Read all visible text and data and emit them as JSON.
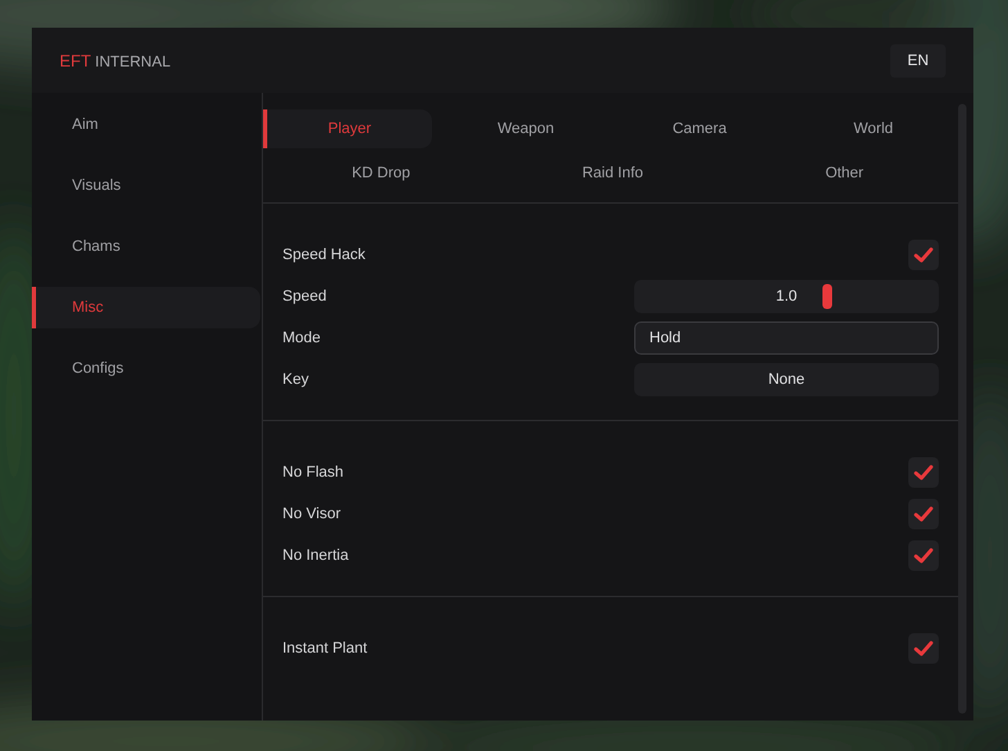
{
  "window": {
    "brand": "EFT",
    "title": "INTERNAL",
    "language_button": "EN"
  },
  "sidebar": {
    "items": [
      {
        "label": "Aim",
        "selected": false
      },
      {
        "label": "Visuals",
        "selected": false
      },
      {
        "label": "Chams",
        "selected": false
      },
      {
        "label": "Misc",
        "selected": true
      },
      {
        "label": "Configs",
        "selected": false
      }
    ]
  },
  "tabs": [
    [
      {
        "label": "Player",
        "selected": true
      },
      {
        "label": "Weapon",
        "selected": false
      },
      {
        "label": "Camera",
        "selected": false
      },
      {
        "label": "World",
        "selected": false
      }
    ],
    [
      {
        "label": "KD Drop",
        "selected": false
      },
      {
        "label": "Raid Info",
        "selected": false
      },
      {
        "label": "Other",
        "selected": false
      }
    ]
  ],
  "sections": [
    {
      "rows": [
        {
          "kind": "checkbox",
          "label": "Speed Hack",
          "checked": true
        },
        {
          "kind": "slider",
          "label": "Speed",
          "value": "1.0",
          "level": 0.64
        },
        {
          "kind": "dropdown",
          "label": "Mode",
          "value": "Hold"
        },
        {
          "kind": "keybind",
          "label": "Key",
          "value": "None"
        }
      ]
    },
    {
      "rows": [
        {
          "kind": "checkbox",
          "label": "No Flash",
          "checked": true
        },
        {
          "kind": "checkbox",
          "label": "No Visor",
          "checked": true
        },
        {
          "kind": "checkbox",
          "label": "No Inertia",
          "checked": true
        }
      ]
    },
    {
      "rows": [
        {
          "kind": "checkbox",
          "label": "Instant Plant",
          "checked": true
        }
      ]
    }
  ]
}
